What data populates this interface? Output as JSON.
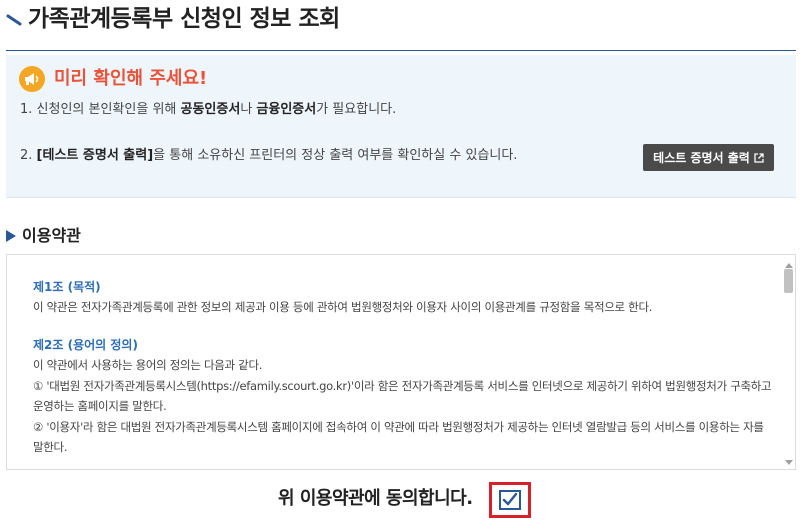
{
  "header": {
    "title": "가족관계등록부 신청인 정보 조회"
  },
  "notice": {
    "title": "미리 확인해 주세요!",
    "line1": {
      "prefix": "1. 신청인의 본인확인을 위해 ",
      "cert1": "공동인증서",
      "mid": "나 ",
      "cert2": "금융인증서",
      "suffix": "가 필요합니다."
    },
    "line2": {
      "prefix": "2. ",
      "bold": "[테스트 증명서 출력]",
      "suffix": "을 통해 소유하신 프린터의 정상 출력 여부를 확인하실 수 있습니다."
    },
    "test_button_label": "테스트 증명서 출력"
  },
  "terms": {
    "section_title": "이용약관",
    "article1_title": "제1조 (목적)",
    "article1_text": "이 약관은 전자가족관계등록에 관한 정보의 제공과 이용 등에 관하여 법원행정처와 이용자 사이의 이용관계를 규정함을 목적으로 한다.",
    "article2_title": "제2조 (용어의 정의)",
    "article2_intro": "이 약관에서 사용하는 용어의 정의는 다음과 같다.",
    "article2_item1": "① '대법원 전자가족관계등록시스템(https://efamily.scourt.go.kr)'이라 함은 전자가족관계등록 서비스를 인터넷으로 제공하기 위하여 법원행정처가 구축하고 운영하는 홈페이지를 말한다.",
    "article2_item2": "② '이용자'라 함은 대법원 전자가족관계등록시스템 홈페이지에 접속하여 이 약관에 따라 법원행정처가 제공하는 인터넷 열람발급 등의 서비스를 이용하는 자를 말한다."
  },
  "agreement": {
    "label": "위 이용약관에 동의합니다.",
    "checked": true
  },
  "colors": {
    "primary": "#2b5797",
    "notice_title": "#e8543b",
    "notice_bg": "#eef6fc",
    "highlight": "#d6202a",
    "button_bg": "#4a4a4a",
    "terms_heading": "#2e6db4"
  },
  "icons": {
    "title_mark": "diagonal-slash-icon",
    "notice": "megaphone-icon",
    "external": "external-link-icon",
    "section_marker": "triangle-right-icon",
    "checkbox": "checkmark-icon"
  }
}
